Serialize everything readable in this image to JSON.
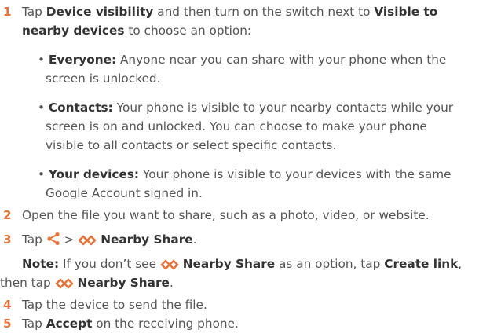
{
  "steps": {
    "s1": {
      "num": "1",
      "t1": "Tap ",
      "b1": "Device visibility",
      "t2": " and then turn on the switch next to ",
      "b2": "Visible to",
      "b3": "nearby devices",
      "t3": " to choose an option:"
    },
    "options": [
      {
        "bullet": "•",
        "name": "Everyone:",
        "l1": " Anyone near you can share with your phone when the",
        "l2": "screen is unlocked."
      },
      {
        "bullet": "•",
        "name": "Contacts:",
        "l1": " Your phone is visible to your nearby contacts while your",
        "l2": "screen is on and unlocked. You can choose to make your phone",
        "l3": "visible to all contacts or select specific contacts."
      },
      {
        "bullet": "•",
        "name": "Your devices:",
        "l1": " Your phone is visible to your devices with the same",
        "l2": "Google Account signed in."
      }
    ],
    "s2": {
      "num": "2",
      "text": "Open the file you want to share, such as a photo, video, or website."
    },
    "s3": {
      "num": "3",
      "t1": "Tap ",
      "sep": " > ",
      "b1": "Nearby Share",
      "t2": ".",
      "note_label": "Note:",
      "n1": " If you don’t see ",
      "n_b1": "Nearby Share",
      "n2": " as an option, tap ",
      "n_b2": "Create link",
      "n3": ",",
      "n4": "then tap ",
      "n_b3": "Nearby Share",
      "n5": "."
    },
    "s4": {
      "num": "4",
      "text": "Tap the device to send the file."
    },
    "s5": {
      "num": "5",
      "t1": "Tap ",
      "b1": "Accept",
      "t2": " on the receiving phone."
    }
  },
  "colors": {
    "accent": "#e8743b",
    "text": "#555555",
    "bold_text": "#333333"
  },
  "icons": {
    "share": "share-icon",
    "nearby": "nearby-share-icon"
  }
}
